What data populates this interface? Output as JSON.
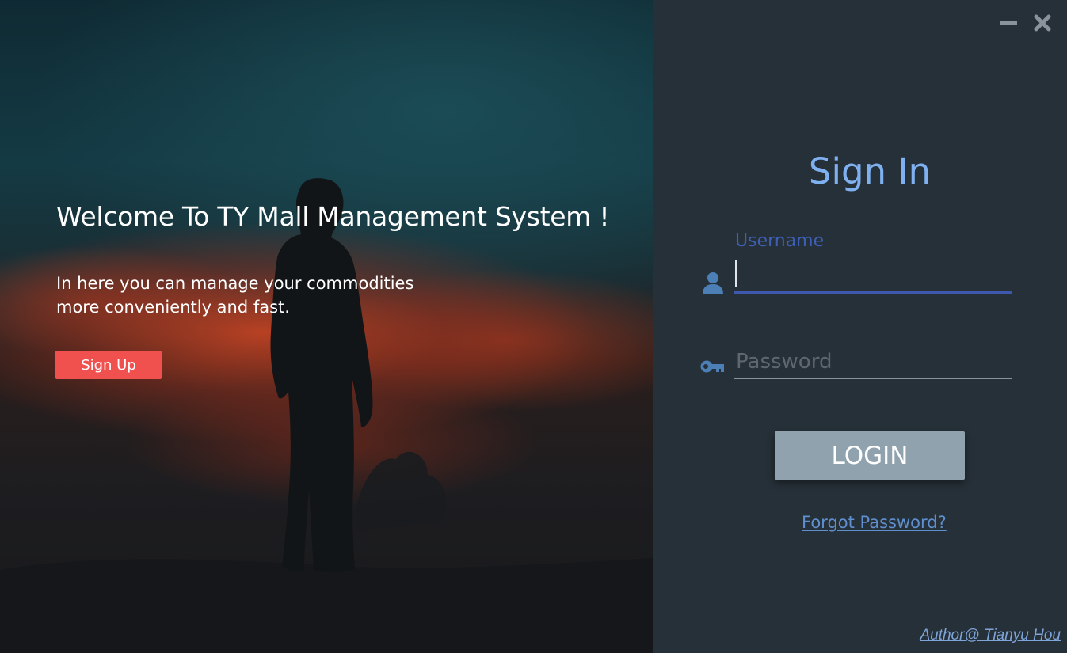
{
  "window": {
    "minimize_icon": "minimize-icon",
    "close_icon": "close-icon"
  },
  "hero": {
    "title": "Welcome To TY Mall Management System !",
    "description_line1": "In here you can manage your commodities",
    "description_line2": "more conveniently and fast.",
    "signup_label": "Sign Up"
  },
  "login": {
    "title": "Sign In",
    "username_label": "Username",
    "username_value": "",
    "password_placeholder": "Password",
    "password_value": "",
    "login_label": "LOGIN",
    "forgot_label": "Forgot Password?",
    "user_icon": "user-icon",
    "key_icon": "key-icon"
  },
  "footer": {
    "author": "Author@ Tianyu Hou"
  },
  "colors": {
    "signup_button": "#f0514f",
    "signin_title": "#7fb0f0",
    "username_accent": "#3f58ad",
    "login_button": "#8fa2ad",
    "panel_background": "#263038",
    "link": "#5f8fce"
  }
}
